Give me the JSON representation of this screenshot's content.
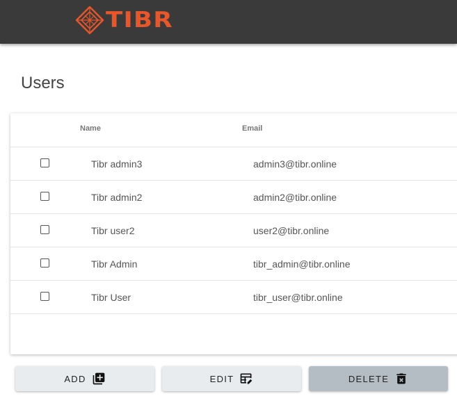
{
  "header": {
    "logo_text": "TIBR",
    "brand_color": "#e8562a",
    "bar_color": "#3a3a3a"
  },
  "page": {
    "title": "Users"
  },
  "table": {
    "columns": {
      "name": "Name",
      "email": "Email"
    },
    "rows": [
      {
        "name": "Tibr admin3",
        "email": "admin3@tibr.online",
        "checked": false
      },
      {
        "name": "Tibr admin2",
        "email": "admin2@tibr.online",
        "checked": false
      },
      {
        "name": "Tibr user2",
        "email": "user2@tibr.online",
        "checked": false
      },
      {
        "name": "Tibr Admin",
        "email": "tibr_admin@tibr.online",
        "checked": false
      },
      {
        "name": "Tibr User",
        "email": "tibr_user@tibr.online",
        "checked": false
      }
    ]
  },
  "actions": {
    "add": {
      "label": "ADD",
      "icon": "add-box-icon"
    },
    "edit": {
      "label": "EDIT",
      "icon": "edit-table-icon"
    },
    "delete": {
      "label": "DELETE",
      "icon": "trash-icon"
    }
  }
}
